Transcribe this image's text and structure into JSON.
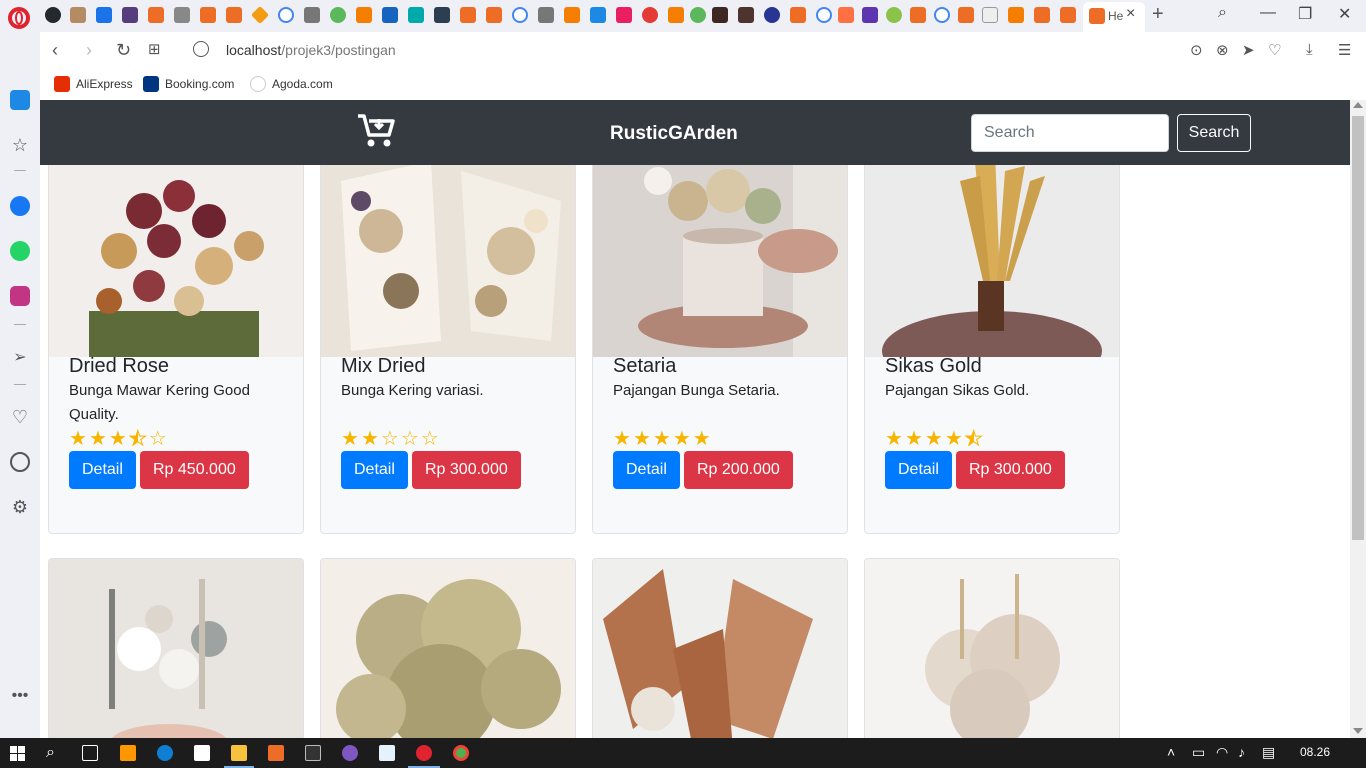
{
  "browser": {
    "active_tab_label": "He",
    "url_host": "localhost",
    "url_path": "/projek3/postingan",
    "bookmarks": [
      "AliExpress",
      "Booking.com",
      "Agoda.com"
    ]
  },
  "site": {
    "brand": "RusticGArden",
    "search_placeholder": "Search",
    "search_button": "Search"
  },
  "products": [
    {
      "title": "Dried Rose",
      "description": "Bunga Mawar Kering Good Quality.",
      "rating": 3.5,
      "detail_label": "Detail",
      "price": "Rp 450.000"
    },
    {
      "title": "Mix Dried",
      "description": "Bunga Kering variasi.",
      "rating": 2,
      "detail_label": "Detail",
      "price": "Rp 300.000"
    },
    {
      "title": "Setaria",
      "description": "Pajangan Bunga Setaria.",
      "rating": 5,
      "detail_label": "Detail",
      "price": "Rp 200.000"
    },
    {
      "title": "Sikas Gold",
      "description": "Pajangan Sikas Gold.",
      "rating": 4.5,
      "detail_label": "Detail",
      "price": "Rp 300.000"
    }
  ],
  "taskbar": {
    "clock": "08.26"
  },
  "colors": {
    "navbar": "#343a40",
    "detail_button": "#007bff",
    "price_button": "#dc3545",
    "star": "#f7b500"
  }
}
